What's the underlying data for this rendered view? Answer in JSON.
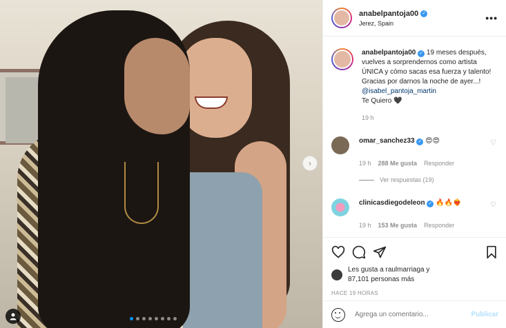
{
  "post": {
    "username": "anabelpantoja00",
    "location": "Jerez, Spain",
    "caption_user": "anabelpantoja00",
    "caption_text": "19 meses después, vuelves a sorprendernos como artista ÚNICA y cómo sacas esa fuerza y talento!",
    "caption_line2": "Gracias por darnos la noche de ayer...!",
    "caption_mention": "@isabel_pantoja_martin",
    "caption_end": "Te Quiero 🖤",
    "caption_time": "19 h"
  },
  "comments": [
    {
      "user": "omar_sanchez33",
      "text": "😍😍",
      "time": "19 h",
      "likes": "288 Me gusta",
      "reply": "Responder",
      "view_replies": "Ver respuestas (19)",
      "avatar_color": "#7a6a55"
    },
    {
      "user": "clinicasdiegodeleon",
      "text": "🔥🔥❤️‍🔥",
      "time": "19 h",
      "likes": "153 Me gusta",
      "reply": "Responder",
      "avatar_color": "#7fd3e0"
    }
  ],
  "likes_summary": {
    "line1": "Les gusta a raulmarriaga y",
    "line2": "87,101 personas más"
  },
  "posted_ago": "HACE 19 HORAS",
  "add_comment": {
    "placeholder": "Agrega un comentario...",
    "post_label": "Publicar"
  },
  "carousel": {
    "count": 8,
    "active": 1
  },
  "colors": {
    "accent": "#0095f6",
    "verified": "#3897f0",
    "mention": "#00376b"
  }
}
